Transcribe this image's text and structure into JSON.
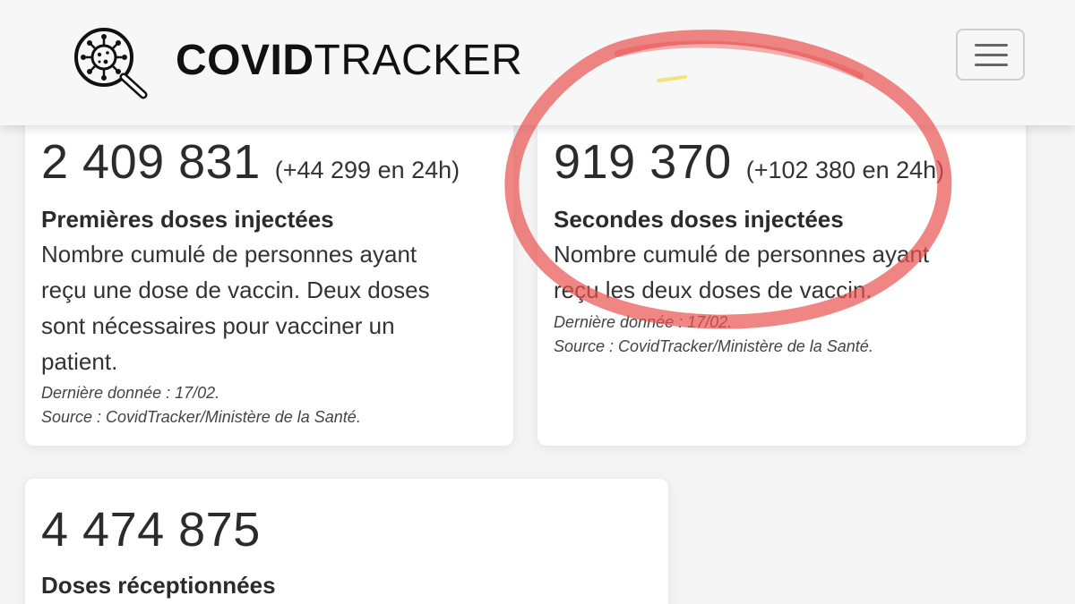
{
  "header": {
    "logo_icon": "virus-magnifier-icon",
    "title_bold": "COVID",
    "title_light": "TRACKER",
    "menu_icon": "hamburger-icon"
  },
  "cards": [
    {
      "value": "2 409 831",
      "delta": "(+44 299 en 24h)",
      "title": "Premières doses injectées",
      "description_lines": [
        "Nombre cumulé de personnes ayant",
        "reçu une dose de vaccin. Deux doses",
        "sont nécessaires pour vacciner un",
        "patient."
      ],
      "last_data": "Dernière donnée : 17/02.",
      "source": "Source : CovidTracker/Ministère de la Santé."
    },
    {
      "value": "919 370",
      "delta": "(+102 380 en 24h)",
      "title": "Secondes doses injectées",
      "description_lines": [
        "Nombre cumulé de personnes ayant",
        "reçu les deux doses de vaccin."
      ],
      "last_data": "Dernière donnée : 17/02.",
      "source": "Source : CovidTracker/Ministère de la Santé."
    },
    {
      "value": "4 474 875",
      "title": "Doses réceptionnées"
    }
  ],
  "colors": {
    "annotation": "#e8534f",
    "highlight": "#f5e27a"
  }
}
